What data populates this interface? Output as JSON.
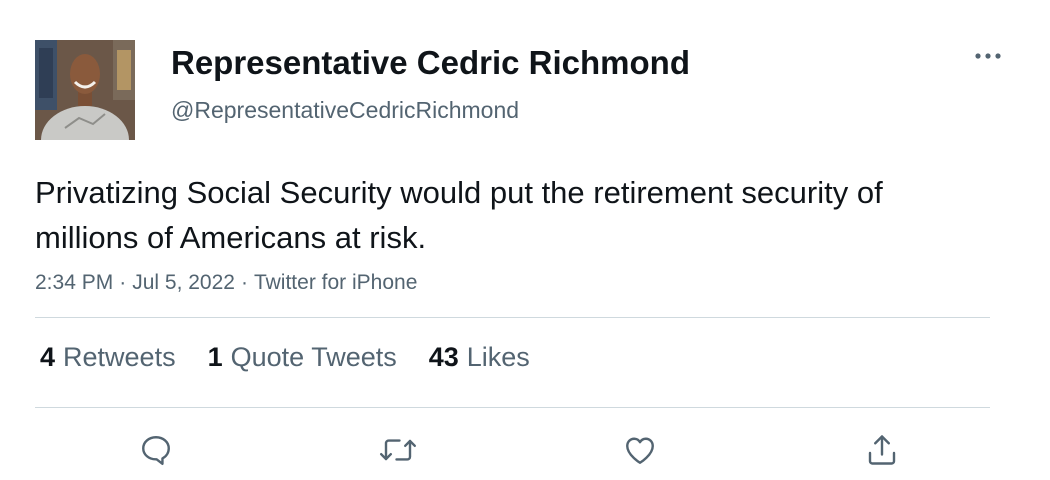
{
  "user": {
    "display_name": "Representative Cedric Richmond",
    "handle": "@RepresentativeCedricRichmond"
  },
  "tweet": {
    "text": "Privatizing Social Security would put the retirement security of millions of Americans at risk.",
    "time": "2:34 PM",
    "date": "Jul 5, 2022",
    "source": "Twitter for iPhone",
    "separator": "·"
  },
  "stats": {
    "retweets_count": "4",
    "retweets_label": "Retweets",
    "quotes_count": "1",
    "quotes_label": "Quote Tweets",
    "likes_count": "43",
    "likes_label": "Likes"
  },
  "icons": {
    "more": "more-horizontal-icon",
    "reply": "reply-bubble-icon",
    "retweet": "retweet-arrows-icon",
    "like": "heart-icon",
    "share": "share-upload-icon"
  },
  "colors": {
    "text_primary": "#0f1419",
    "text_secondary": "#536471",
    "divider": "#cfd9de",
    "icon": "#536471"
  }
}
